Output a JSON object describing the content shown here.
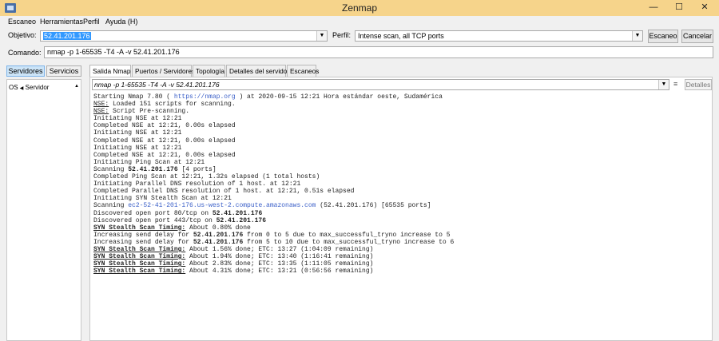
{
  "window": {
    "title": "Zenmap"
  },
  "menu": [
    "Escaneo",
    "Herramientas",
    "Perfil",
    "Ayuda (H)"
  ],
  "target": {
    "label": "Objetivo:",
    "value": "52.41.201.176"
  },
  "profile": {
    "label": "Perfil:",
    "value": "Intense scan, all TCP ports"
  },
  "buttons": {
    "scan": "Escaneo",
    "cancel": "Cancelar",
    "details": "Detalles"
  },
  "command": {
    "label": "Comando:",
    "value": "nmap -p 1-65535 -T4 -A -v 52.41.201.176"
  },
  "sidebar": {
    "tabs": [
      "Servidores",
      "Servicios"
    ],
    "col_os": "OS",
    "col_server": "Servidor"
  },
  "tabs": [
    "Salida Nmap",
    "Puertos / Servidores",
    "Topología",
    "Detalles del servidor",
    "Escaneos"
  ],
  "output": {
    "command": "nmap -p 1-65535 -T4 -A -v 52.41.201.176",
    "lines": [
      [
        {
          "t": "Starting Nmap 7.80 ( "
        },
        {
          "t": "https://nmap.org",
          "c": "link"
        },
        {
          "t": " ) at 2020-09-15 12:21 Hora estándar oeste, Sudamérica"
        }
      ],
      [
        {
          "t": "NSE:",
          "c": "ul"
        },
        {
          "t": " Loaded 151 scripts for scanning."
        }
      ],
      [
        {
          "t": "NSE:",
          "c": "ul"
        },
        {
          "t": " Script Pre-scanning."
        }
      ],
      [
        {
          "t": "Initiating NSE at 12:21"
        }
      ],
      [
        {
          "t": "Completed NSE at 12:21, 0.00s elapsed"
        }
      ],
      [
        {
          "t": "Initiating NSE at 12:21"
        }
      ],
      [
        {
          "t": "Completed NSE at 12:21, 0.00s elapsed"
        }
      ],
      [
        {
          "t": "Initiating NSE at 12:21"
        }
      ],
      [
        {
          "t": "Completed NSE at 12:21, 0.00s elapsed"
        }
      ],
      [
        {
          "t": "Initiating Ping Scan at 12:21"
        }
      ],
      [
        {
          "t": "Scanning "
        },
        {
          "t": "52.41.201.176",
          "c": "ip"
        },
        {
          "t": " [4 ports]"
        }
      ],
      [
        {
          "t": "Completed Ping Scan at 12:21, 1.32s elapsed (1 total hosts)"
        }
      ],
      [
        {
          "t": "Initiating Parallel DNS resolution of 1 host. at 12:21"
        }
      ],
      [
        {
          "t": "Completed Parallel DNS resolution of 1 host. at 12:21, 0.51s elapsed"
        }
      ],
      [
        {
          "t": "Initiating SYN Stealth Scan at 12:21"
        }
      ],
      [
        {
          "t": "Scanning "
        },
        {
          "t": "ec2-52-41-201-176.us-west-2.compute.amazonaws.com",
          "c": "link"
        },
        {
          "t": " (52.41.201.176) [65535 ports]"
        }
      ],
      [
        {
          "t": "Discovered open port 80/tcp on "
        },
        {
          "t": "52.41.201.176",
          "c": "ip"
        }
      ],
      [
        {
          "t": "Discovered open port 443/tcp on "
        },
        {
          "t": "52.41.201.176",
          "c": "ip"
        }
      ],
      [
        {
          "t": "SYN Stealth Scan Timing:",
          "c": "timing"
        },
        {
          "t": " About 0.80% done"
        }
      ],
      [
        {
          "t": "Increasing send delay for "
        },
        {
          "t": "52.41.201.176",
          "c": "ip"
        },
        {
          "t": " from 0 to 5 due to max_successful_tryno increase to 5"
        }
      ],
      [
        {
          "t": "Increasing send delay for "
        },
        {
          "t": "52.41.201.176",
          "c": "ip"
        },
        {
          "t": " from 5 to 10 due to max_successful_tryno increase to 6"
        }
      ],
      [
        {
          "t": "SYN Stealth Scan Timing:",
          "c": "timing"
        },
        {
          "t": " About 1.56% done; ETC: 13:27 (1:04:09 remaining)"
        }
      ],
      [
        {
          "t": "SYN Stealth Scan Timing:",
          "c": "timing"
        },
        {
          "t": " About 1.94% done; ETC: 13:40 (1:16:41 remaining)"
        }
      ],
      [
        {
          "t": "SYN Stealth Scan Timing:",
          "c": "timing"
        },
        {
          "t": " About 2.83% done; ETC: 13:35 (1:11:05 remaining)"
        }
      ],
      [
        {
          "t": "SYN Stealth Scan Timing:",
          "c": "timing"
        },
        {
          "t": " About 4.31% done; ETC: 13:21 (0:56:56 remaining)"
        }
      ]
    ]
  }
}
